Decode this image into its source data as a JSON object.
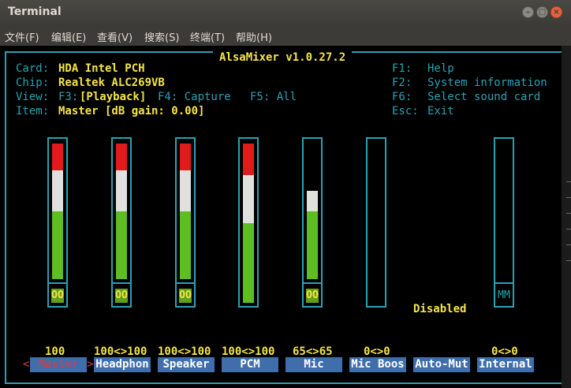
{
  "window": {
    "title": "Terminal",
    "menu": [
      "文件(F)",
      "编辑(E)",
      "查看(V)",
      "搜索(S)",
      "终端(T)",
      "帮助(H)"
    ]
  },
  "alsamixer": {
    "title": "AlsaMixer v1.0.27.2",
    "card_label": "Card:",
    "card": "HDA Intel PCH",
    "chip_label": "Chip:",
    "chip": "Realtek ALC269VB",
    "view_label": "View:",
    "view_f3": "F3:",
    "view_playback": "[Playback]",
    "view_f4": "F4: Capture",
    "view_f5": "F5: All",
    "item_label": "Item:",
    "item": "Master [dB gain: 0.00]",
    "help": [
      {
        "key": "F1:",
        "text": "Help"
      },
      {
        "key": "F2:",
        "text": "System information"
      },
      {
        "key": "F6:",
        "text": "Select sound card"
      },
      {
        "key": "Esc:",
        "text": "Exit"
      }
    ],
    "disabled_text": "Disabled",
    "channels": [
      {
        "name": "Master",
        "volume_text": "100",
        "mute": "OO",
        "level": 1.0
      },
      {
        "name": "Headphon",
        "volume_text": "100<>100",
        "mute": "OO",
        "level": 1.0
      },
      {
        "name": "Speaker",
        "volume_text": "100<>100",
        "mute": "OO",
        "level": 1.0
      },
      {
        "name": "PCM",
        "volume_text": "100<>100",
        "mute": "",
        "level": 1.0
      },
      {
        "name": "Mic",
        "volume_text": "65<>65",
        "mute": "OO",
        "level": 0.65
      },
      {
        "name": "Mic Boos",
        "volume_text": "0<>0",
        "mute": "",
        "level": 0
      },
      {
        "name": "Auto-Mut",
        "volume_text": "",
        "mute": "",
        "level": 0
      },
      {
        "name": "Internal",
        "volume_text": "0<>0",
        "mute": "MM",
        "level": 0
      }
    ],
    "selected_markers": [
      "<",
      ">"
    ]
  },
  "colors": {
    "border": "#2aa1b3",
    "yellow": "#f6e44a",
    "bar_green": "#5fbd1f",
    "bar_white": "#e0e0dc",
    "bar_red": "#e01b1b",
    "ctrl_bg": "#3f6eab"
  }
}
